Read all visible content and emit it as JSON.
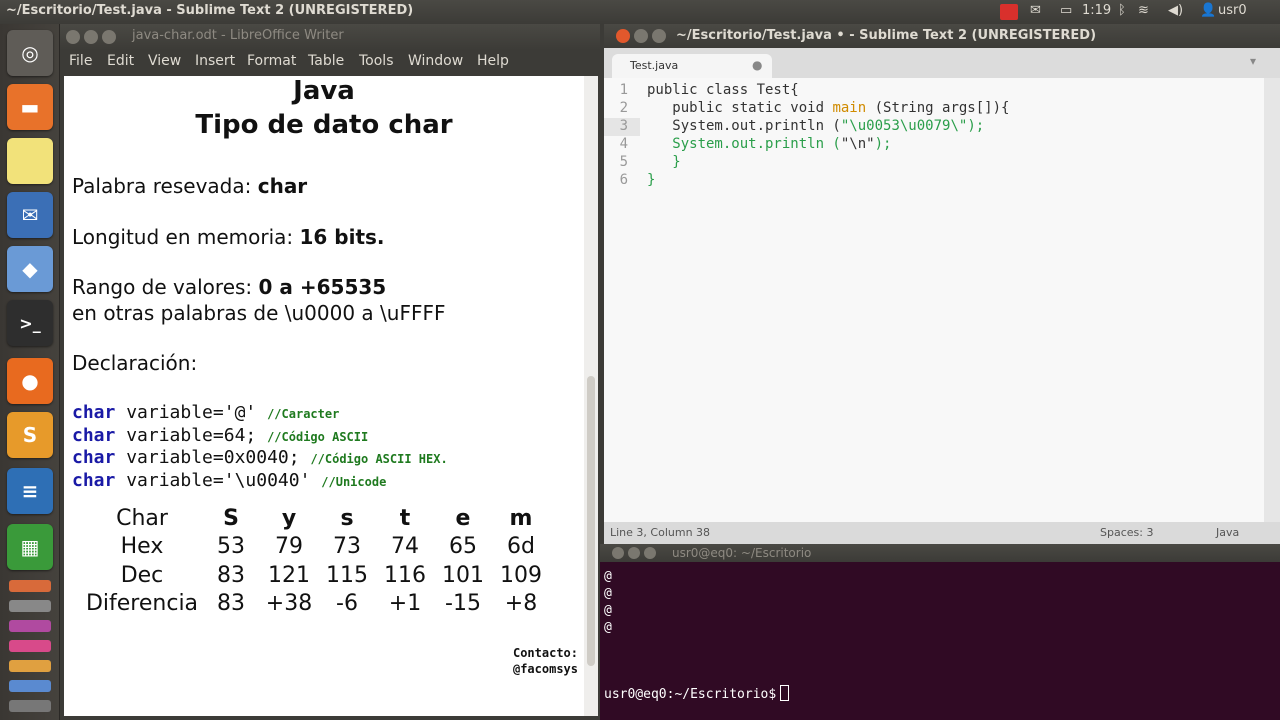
{
  "top_panel": {
    "title": "~/Escritorio/Test.java - Sublime Text 2 (UNREGISTERED)",
    "clock": "1:19",
    "user": "usr0"
  },
  "writer": {
    "title": "java-char.odt - LibreOffice Writer",
    "menu": [
      "File",
      "Edit",
      "View",
      "Insert",
      "Format",
      "Table",
      "Tools",
      "Window",
      "Help"
    ],
    "doc": {
      "title1": "Java",
      "title2": "Tipo de dato char",
      "reserved_label": "Palabra resevada: ",
      "reserved_value": "char",
      "length_label": "Longitud en memoria: ",
      "length_value": "16 bits.",
      "range_label": "Rango de valores: ",
      "range_value": "0 a +65535",
      "range_other": "en otras palabras de \\u0000 a \\uFFFF",
      "declaration": "Declaración:",
      "code": [
        {
          "kw": "char",
          "text": " variable='@' ",
          "comment": "//Caracter"
        },
        {
          "kw": "char",
          "text": " variable=64; ",
          "comment": "//Código ASCII"
        },
        {
          "kw": "char",
          "text": " variable=0x0040; ",
          "comment": "//Código ASCII HEX."
        },
        {
          "kw": "char",
          "text": " variable='\\u0040' ",
          "comment": "//Unicode"
        }
      ],
      "table": {
        "headers": [
          "Char",
          "S",
          "y",
          "s",
          "t",
          "e",
          "m"
        ],
        "rows": [
          [
            "Hex",
            "53",
            "79",
            "73",
            "74",
            "65",
            "6d"
          ],
          [
            "Dec",
            "83",
            "121",
            "115",
            "116",
            "101",
            "109"
          ],
          [
            "Diferencia",
            "83",
            "+38",
            "-6",
            "+1",
            "-15",
            "+8"
          ]
        ]
      },
      "contact_label": "Contacto:",
      "contact_value": "@facomsys"
    }
  },
  "sublime": {
    "title": "~/Escritorio/Test.java • - Sublime Text 2 (UNREGISTERED)",
    "tab": "Test.java",
    "line_numbers": [
      "1",
      "2",
      "3",
      "4",
      "5",
      "6"
    ],
    "lines": {
      "l1": "public class Test{",
      "l2a": "   public static void ",
      "l2fn": "main",
      "l2b": " (String args[]){",
      "l3a": "   System.out.println (",
      "l3s": "\"\\u0053\\u0079\\\"",
      "l3b": ");",
      "l4a": "   System.out.println (",
      "l4s": "\"\\n\"",
      "l4b": ");",
      "l5": "   }",
      "l6": "}"
    },
    "status": {
      "position": "Line 3, Column 38",
      "spaces": "Spaces: 3",
      "syntax": "Java"
    }
  },
  "terminal": {
    "title": "usr0@eq0: ~/Escritorio",
    "output": [
      "@",
      "@",
      "@",
      "@"
    ],
    "prompt": "usr0@eq0:~/Escritorio$"
  },
  "colors": {
    "terminal_bg": "#300a24",
    "keyword": "#1a1aa6",
    "comment": "#1f7a1f",
    "string": "#2a9e4a"
  }
}
